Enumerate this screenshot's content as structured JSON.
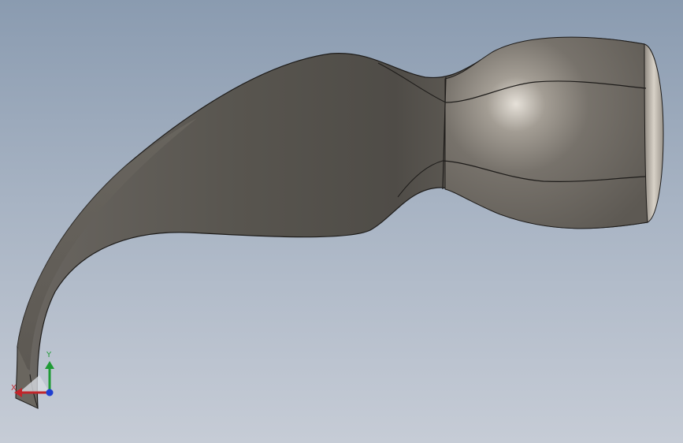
{
  "viewport": {
    "background_top": "#8a9bb0",
    "background_bottom": "#c6ccd6"
  },
  "model": {
    "body_color": "#5e5b56",
    "edge_color": "#1e1c1a",
    "highlight_color": "#d9d4cc"
  },
  "triad": {
    "x_label": "X",
    "y_label": "Y",
    "x_color": "#c0262b",
    "y_color": "#1f9a35",
    "z_color": "#1f3fd0"
  }
}
